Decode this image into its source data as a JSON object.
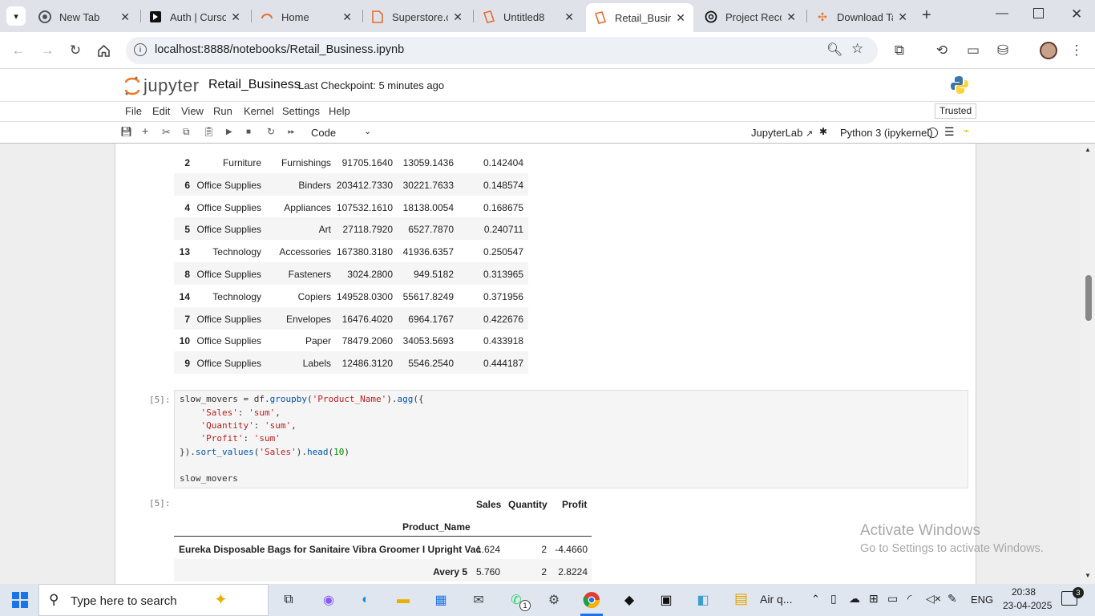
{
  "browser": {
    "tabs": [
      {
        "title": "New Tab",
        "icon": "chrome-icon"
      },
      {
        "title": "Auth | Cursor",
        "icon": "cursor-icon"
      },
      {
        "title": "Home",
        "icon": "jupyter-home-icon"
      },
      {
        "title": "Superstore.csv",
        "icon": "file-icon"
      },
      {
        "title": "Untitled8",
        "icon": "notebook-icon"
      },
      {
        "title": "Retail_Business",
        "icon": "notebook-icon"
      },
      {
        "title": "Project Recommendations",
        "icon": "openai-icon"
      },
      {
        "title": "Download Tableau",
        "icon": "tableau-icon"
      }
    ],
    "url": "localhost:8888/notebooks/Retail_Business.ipynb"
  },
  "jupyter": {
    "logo_text": "jupyter",
    "notebook_name": "Retail_Business",
    "checkpoint": "Last Checkpoint: 5 minutes ago",
    "menu": [
      "File",
      "Edit",
      "View",
      "Run",
      "Kernel",
      "Settings",
      "Help"
    ],
    "trusted": "Trusted",
    "cell_type": "Code",
    "jupyterlab_link": "JupyterLab",
    "kernel": "Python 3 (ipykernel)"
  },
  "table1": {
    "rows": [
      {
        "idx": "2",
        "category": "Furniture",
        "subcat": "Furnishings",
        "sales": "91705.1640",
        "profit": "13059.1436",
        "ratio": "0.142404"
      },
      {
        "idx": "6",
        "category": "Office Supplies",
        "subcat": "Binders",
        "sales": "203412.7330",
        "profit": "30221.7633",
        "ratio": "0.148574"
      },
      {
        "idx": "4",
        "category": "Office Supplies",
        "subcat": "Appliances",
        "sales": "107532.1610",
        "profit": "18138.0054",
        "ratio": "0.168675"
      },
      {
        "idx": "5",
        "category": "Office Supplies",
        "subcat": "Art",
        "sales": "27118.7920",
        "profit": "6527.7870",
        "ratio": "0.240711"
      },
      {
        "idx": "13",
        "category": "Technology",
        "subcat": "Accessories",
        "sales": "167380.3180",
        "profit": "41936.6357",
        "ratio": "0.250547"
      },
      {
        "idx": "8",
        "category": "Office Supplies",
        "subcat": "Fasteners",
        "sales": "3024.2800",
        "profit": "949.5182",
        "ratio": "0.313965"
      },
      {
        "idx": "14",
        "category": "Technology",
        "subcat": "Copiers",
        "sales": "149528.0300",
        "profit": "55617.8249",
        "ratio": "0.371956"
      },
      {
        "idx": "7",
        "category": "Office Supplies",
        "subcat": "Envelopes",
        "sales": "16476.4020",
        "profit": "6964.1767",
        "ratio": "0.422676"
      },
      {
        "idx": "10",
        "category": "Office Supplies",
        "subcat": "Paper",
        "sales": "78479.2060",
        "profit": "34053.5693",
        "ratio": "0.433918"
      },
      {
        "idx": "9",
        "category": "Office Supplies",
        "subcat": "Labels",
        "sales": "12486.3120",
        "profit": "5546.2540",
        "ratio": "0.444187"
      }
    ]
  },
  "cell5": {
    "prompt_in": "[5]:",
    "prompt_out": "[5]:",
    "line1_a": "slow_movers = df.",
    "line1_fn": "groupby",
    "line1_b": "(",
    "line1_str": "'Product_Name'",
    "line1_c": ").",
    "line1_fn2": "agg",
    "line1_d": "({",
    "line2_key": "'Sales'",
    "line2_val": "'sum'",
    "line3_key": "'Quantity'",
    "line3_val": "'sum'",
    "line4_key": "'Profit'",
    "line4_val": "'sum'",
    "line5_a": "}).",
    "line5_fn": "sort_values",
    "line5_str": "'Sales'",
    "line5_fn2": "head",
    "line5_num": "10",
    "line6": "slow_movers"
  },
  "table2": {
    "headers": [
      "Sales",
      "Quantity",
      "Profit"
    ],
    "index_name": "Product_Name",
    "rows": [
      {
        "name": "Eureka Disposable Bags for Sanitaire Vibra Groomer I Upright Vac",
        "sales": "1.624",
        "qty": "2",
        "profit": "-4.4660"
      },
      {
        "name": "Avery 5",
        "sales": "5.760",
        "qty": "2",
        "profit": "2.8224"
      }
    ]
  },
  "watermark": {
    "title": "Activate Windows",
    "subtitle": "Go to Settings to activate Windows."
  },
  "taskbar": {
    "search_placeholder": "Type here to search",
    "weather": "Air q...",
    "lang": "ENG",
    "time": "20:38",
    "date": "23-04-2025",
    "notif_count": "3",
    "whatsapp_badge": "1"
  }
}
